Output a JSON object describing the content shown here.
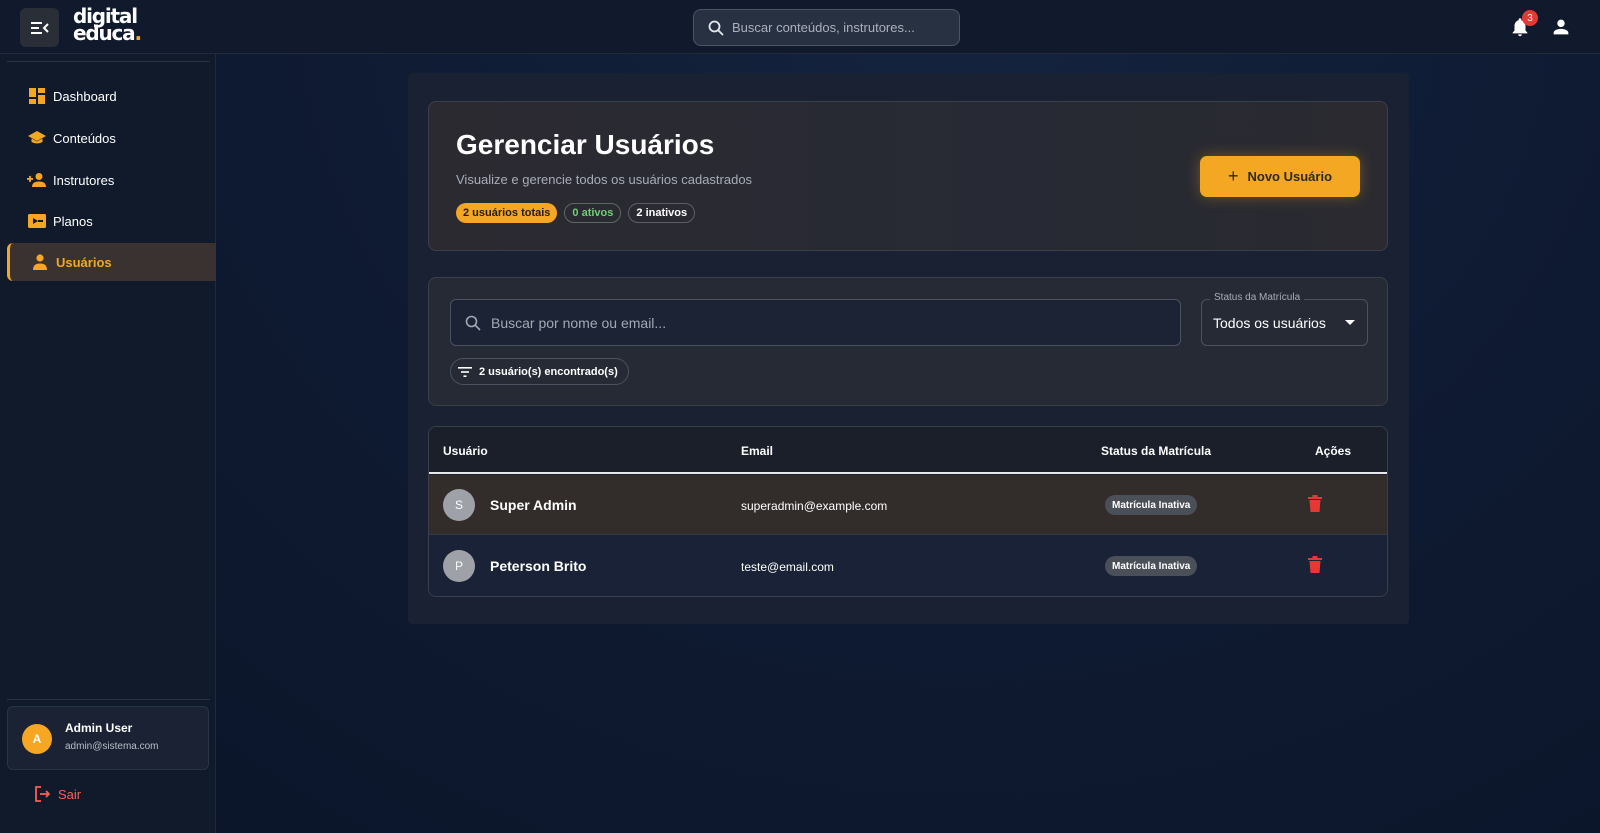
{
  "brand": {
    "line1": "digital",
    "line2": "educa",
    "dot": ".",
    "accent": "#f5a623"
  },
  "topbar": {
    "search_placeholder": "Buscar conteúdos, instrutores...",
    "notifications_count": "3"
  },
  "sidebar": {
    "items": [
      {
        "label": "Dashboard",
        "icon": "dashboard-icon"
      },
      {
        "label": "Conteúdos",
        "icon": "graduation-cap-icon"
      },
      {
        "label": "Instrutores",
        "icon": "person-add-icon"
      },
      {
        "label": "Planos",
        "icon": "ticket-icon"
      },
      {
        "label": "Usuários",
        "icon": "person-icon",
        "active": true
      }
    ],
    "user": {
      "initial": "A",
      "name": "Admin User",
      "email": "admin@sistema.com"
    },
    "logout_label": "Sair"
  },
  "header": {
    "title": "Gerenciar Usuários",
    "subtitle": "Visualize e gerencie todos os usuários cadastrados",
    "chips": {
      "total": "2 usuários totais",
      "active": "0 ativos",
      "inactive": "2 inativos"
    },
    "new_button": "Novo Usuário"
  },
  "filters": {
    "search_placeholder": "Buscar por nome ou email...",
    "status_label": "Status da Matrícula",
    "status_value": "Todos os usuários",
    "found": "2 usuário(s) encontrado(s)"
  },
  "table": {
    "columns": [
      "Usuário",
      "Email",
      "Status da Matrícula",
      "Ações"
    ],
    "rows": [
      {
        "initial": "S",
        "name": "Super Admin",
        "email": "superadmin@example.com",
        "status": "Matrícula Inativa"
      },
      {
        "initial": "P",
        "name": "Peterson Brito",
        "email": "teste@email.com",
        "status": "Matrícula Inativa"
      }
    ]
  },
  "colors": {
    "accent": "#f5a623",
    "danger": "#e53935",
    "active_green": "#6fcf72"
  }
}
